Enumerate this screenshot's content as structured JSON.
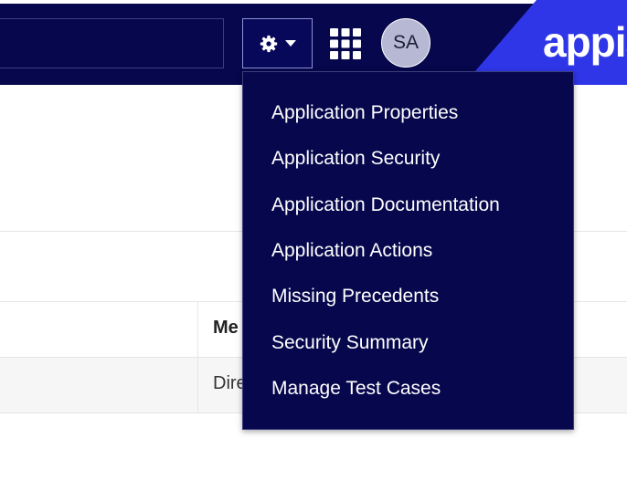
{
  "header": {
    "search_value": "",
    "avatar_initials": "SA",
    "logo_text": "appian",
    "settings_icon": "gear-icon",
    "apps_icon": "grid-icon",
    "colors": {
      "bar": "#06074c",
      "logo_bg": "#2f36e8"
    }
  },
  "table": {
    "columns": [
      "Me"
    ],
    "rows": [
      [
        "Dire"
      ]
    ]
  },
  "settings_menu": {
    "items": [
      "Application Properties",
      "Application Security",
      "Application Documentation",
      "Application Actions",
      "Missing Precedents",
      "Security Summary",
      "Manage Test Cases"
    ]
  }
}
